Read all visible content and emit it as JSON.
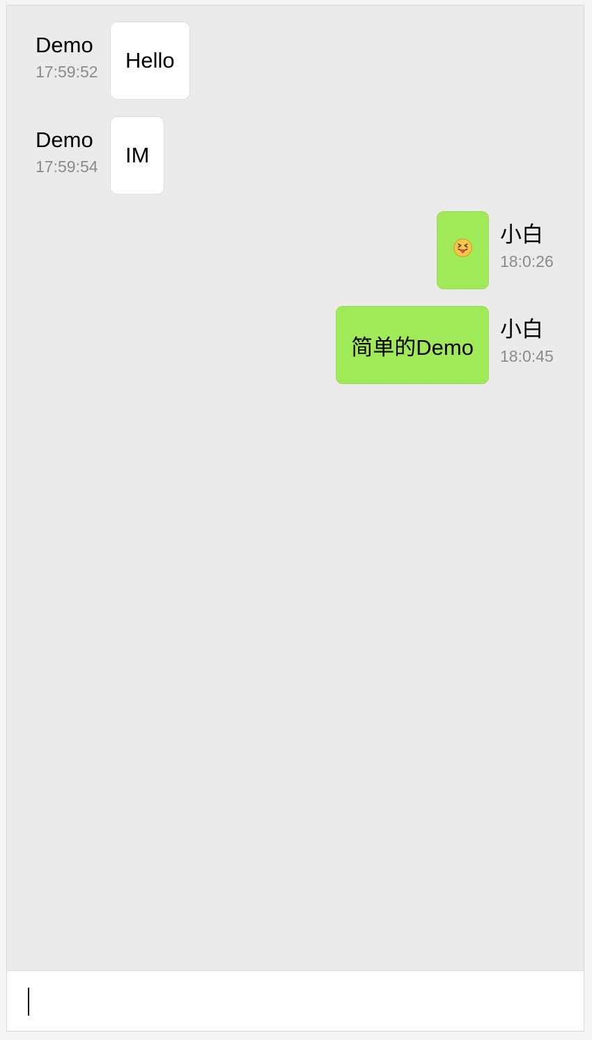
{
  "messages": [
    {
      "side": "left",
      "sender": "Demo",
      "time": "17:59:52",
      "text": "Hello"
    },
    {
      "side": "left",
      "sender": "Demo",
      "time": "17:59:54",
      "text": "IM"
    },
    {
      "side": "right",
      "sender": "小白",
      "time": "18:0:26",
      "icon": "squinting-face-with-tongue-icon"
    },
    {
      "side": "right",
      "sender": "小白",
      "time": "18:0:45",
      "text": "简单的Demo"
    }
  ],
  "composer": {
    "value": "",
    "placeholder": ""
  },
  "colors": {
    "chat_background": "#ebebeb",
    "incoming_bubble": "#ffffff",
    "outgoing_bubble": "#a0e959",
    "timestamp": "#8a8a8a"
  }
}
